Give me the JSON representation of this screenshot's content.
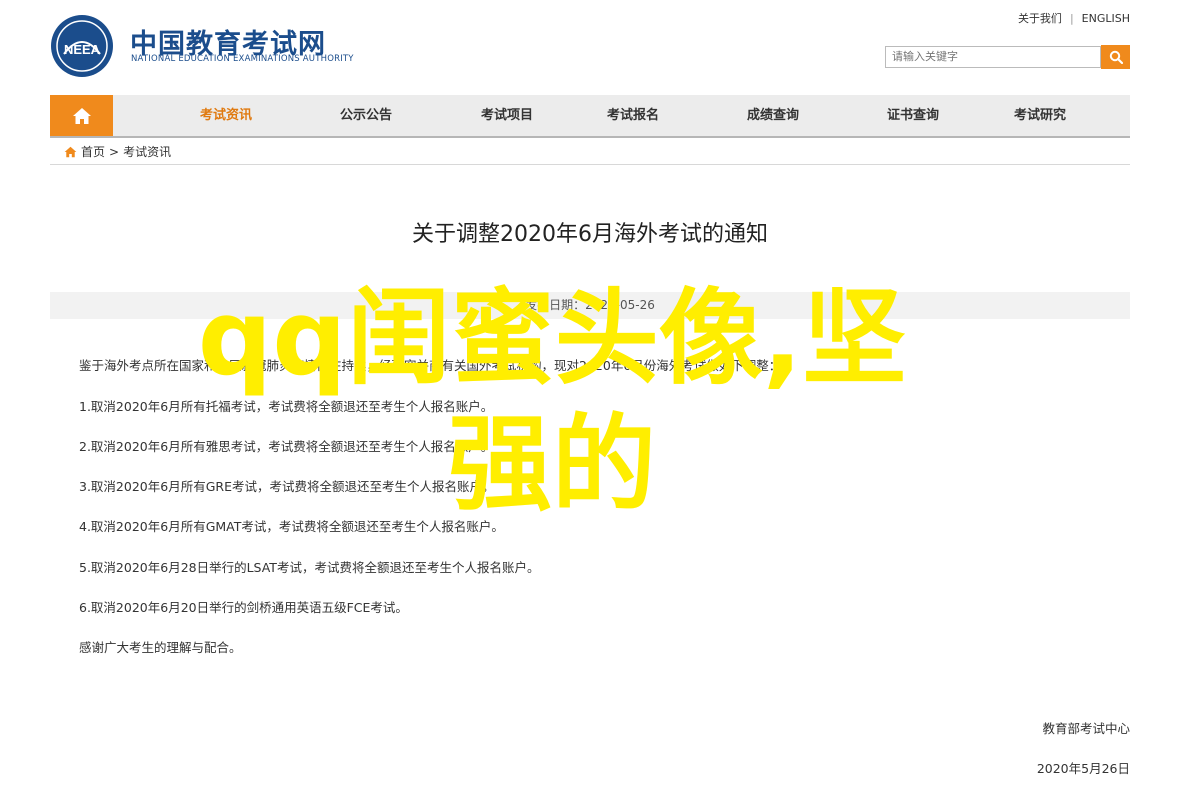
{
  "header": {
    "logo_cn": "中国教育考试网",
    "logo_en": "NATIONAL EDUCATION EXAMINATIONS AUTHORITY",
    "emblem_text": "NEEA",
    "top_links": {
      "favorites": "关于我们",
      "english": "ENGLISH"
    },
    "search": {
      "placeholder": "请输入关键字"
    }
  },
  "nav": {
    "items": [
      {
        "label": "考试资讯"
      },
      {
        "label": "公示公告"
      },
      {
        "label": "考试项目"
      },
      {
        "label": "考试报名"
      },
      {
        "label": "成绩查询"
      },
      {
        "label": "证书查询"
      },
      {
        "label": "考试研究"
      }
    ]
  },
  "breadcrumb": {
    "home": "首页",
    "separator": ">",
    "current": "考试资讯"
  },
  "article": {
    "title": "关于调整2020年6月海外考试的通知",
    "meta": "发布日期：2020-05-26",
    "paragraphs": [
      "鉴于海外考点所在国家和地区新冠肺炎疫情仍在持续，经研究并商有关国外考试机构，现对2020年6月份海外考试做如下调整：",
      "1.取消2020年6月所有托福考试，考试费将全额退还至考生个人报名账户。",
      "2.取消2020年6月所有雅思考试，考试费将全额退还至考生个人报名账户。",
      "3.取消2020年6月所有GRE考试，考试费将全额退还至考生个人报名账户。",
      "4.取消2020年6月所有GMAT考试，考试费将全额退还至考生个人报名账户。",
      "5.取消2020年6月28日举行的LSAT考试，考试费将全额退还至考生个人报名账户。",
      "6.取消2020年6月20日举行的剑桥通用英语五级FCE考试。",
      "感谢广大考生的理解与配合。"
    ],
    "signature": "教育部考试中心",
    "date": "2020年5月26日"
  },
  "overlay": {
    "line1": "qq闺蜜头像,坚",
    "line2": "强的"
  },
  "colors": {
    "accent": "#f08a1c",
    "brand": "#1b4d8c",
    "overlay": "#ffee00"
  }
}
